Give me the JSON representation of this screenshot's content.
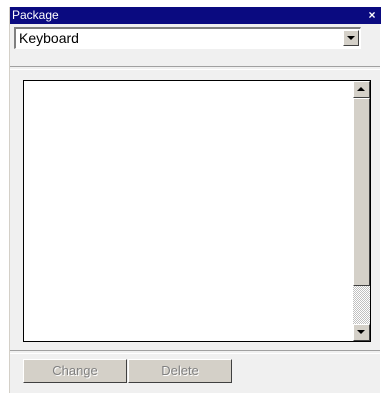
{
  "window": {
    "title": "Package",
    "close_glyph": "×"
  },
  "package_select": {
    "value": "Keyboard"
  },
  "list": {
    "items": []
  },
  "buttons": {
    "change_label": "Change",
    "delete_label": "Delete",
    "enabled": false
  },
  "colors": {
    "titlebar": "#0a0a80",
    "disabled_text": "#808080"
  }
}
